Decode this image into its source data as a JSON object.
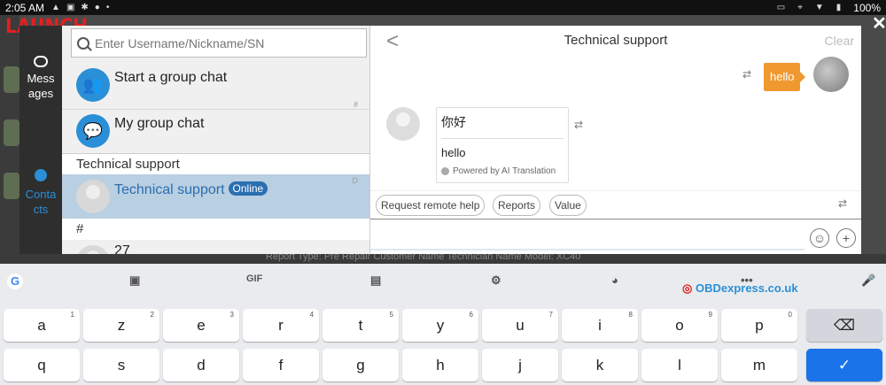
{
  "status_bar": {
    "time": "2:05 AM",
    "battery": "100%"
  },
  "brand": {
    "logo": "LAUNCH"
  },
  "nav": [
    {
      "label": "Mess ages",
      "icon": "chat-bubble-icon"
    },
    {
      "label": "Conta cts",
      "icon": "person-icon"
    }
  ],
  "search": {
    "placeholder": "Enter Username/Nickname/SN"
  },
  "contacts": {
    "start_group": "Start a group chat",
    "my_group": "My group chat",
    "index_hash": "#",
    "section_technical": "Technical support",
    "selected_contact": "Technical support",
    "online_badge": "Online",
    "index_d": "D",
    "section_hash": "#",
    "next_contact": "27"
  },
  "chat": {
    "back": "<",
    "title": "Technical support",
    "clear": "Clear",
    "my_message": "hello",
    "incoming_original": "你好",
    "incoming_translation": "hello",
    "powered_by": "Powered by AI Translation",
    "quick_actions": [
      "Request remote help",
      "Reports",
      "Value"
    ]
  },
  "background": {
    "strip_text": "Report Type: Pre Repair   Customer Name   Technician Name   Model: XC40"
  },
  "keyboard": {
    "toolbar": [
      "sticker-icon",
      "GIF",
      "clipboard-icon",
      "settings-icon",
      "palette-icon",
      "...",
      "mic-icon"
    ],
    "gif_label": "GIF",
    "more_label": "•••",
    "row1": [
      {
        "k": "a",
        "n": "1"
      },
      {
        "k": "z",
        "n": "2"
      },
      {
        "k": "e",
        "n": "3"
      },
      {
        "k": "r",
        "n": "4"
      },
      {
        "k": "t",
        "n": "5"
      },
      {
        "k": "y",
        "n": "6"
      },
      {
        "k": "u",
        "n": "7"
      },
      {
        "k": "i",
        "n": "8"
      },
      {
        "k": "o",
        "n": "9"
      },
      {
        "k": "p",
        "n": "0"
      }
    ],
    "row2": [
      "q",
      "s",
      "d",
      "f",
      "g",
      "h",
      "j",
      "k",
      "l",
      "m"
    ]
  },
  "watermark": {
    "text": "OBDexpress.co.uk"
  },
  "colors": {
    "accent": "#2a8fd6",
    "outgoing_bubble": "#f09830",
    "selected_row": "#b9cfe2",
    "enter_key": "#1a73e8"
  }
}
